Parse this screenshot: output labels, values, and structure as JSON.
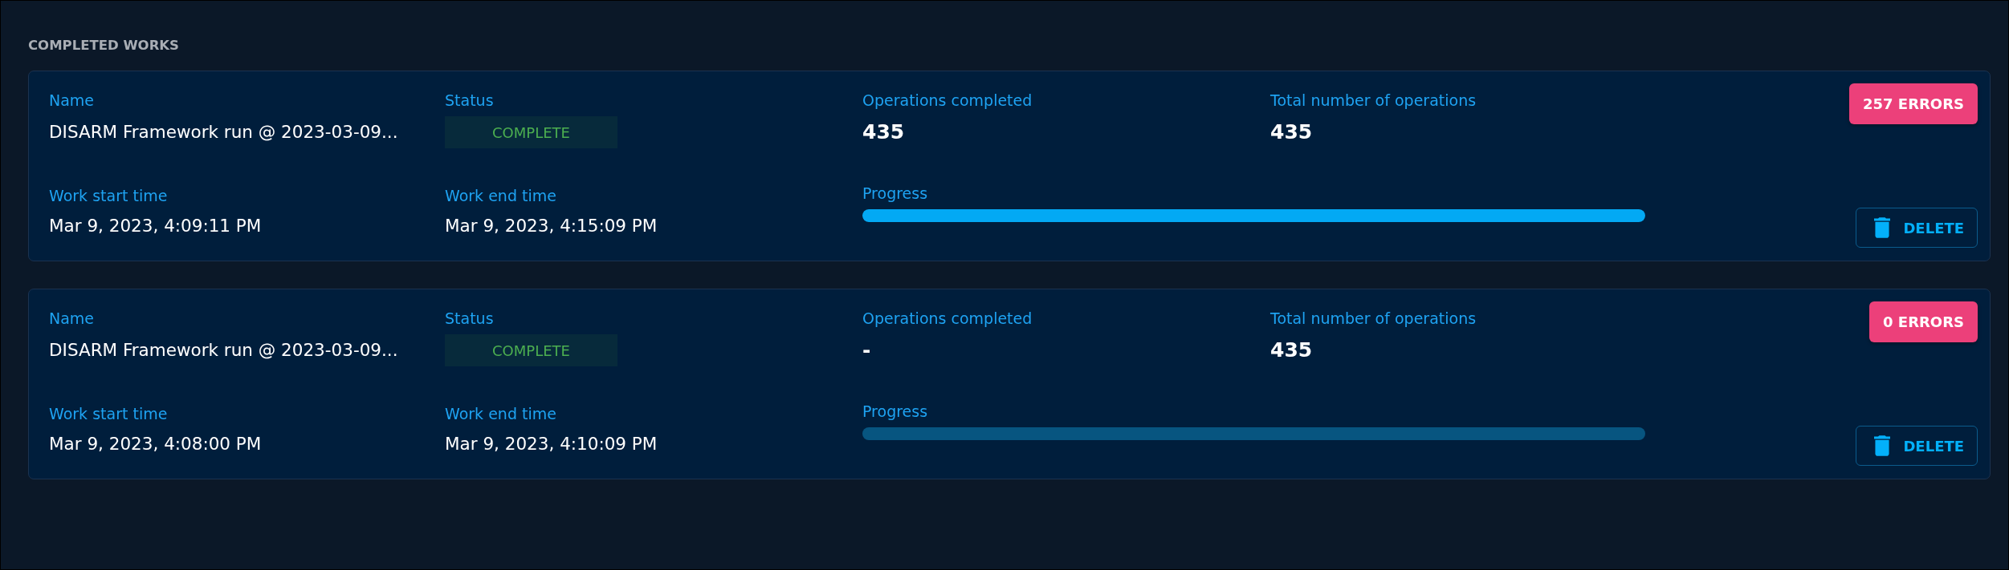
{
  "section": {
    "title": "COMPLETED WORKS"
  },
  "works": [
    {
      "name": {
        "label": "Name",
        "value": "DISARM Framework run @ 2023-03-09..."
      },
      "status": {
        "label": "Status",
        "value": "COMPLETE"
      },
      "operations_completed": {
        "label": "Operations completed",
        "value": "435"
      },
      "total_operations": {
        "label": "Total number of operations",
        "value": "435"
      },
      "errors_button": "257 ERRORS",
      "start_time": {
        "label": "Work start time",
        "value": "Mar 9, 2023, 4:09:11 PM"
      },
      "end_time": {
        "label": "Work end time",
        "value": "Mar 9, 2023, 4:15:09 PM"
      },
      "progress": {
        "label": "Progress",
        "level": 1
      },
      "delete_button": "DELETE"
    },
    {
      "name": {
        "label": "Name",
        "value": "DISARM Framework run @ 2023-03-09..."
      },
      "status": {
        "label": "Status",
        "value": "COMPLETE"
      },
      "operations_completed": {
        "label": "Operations completed",
        "value": "-"
      },
      "total_operations": {
        "label": "Total number of operations",
        "value": "435"
      },
      "errors_button": "0 ERRORS",
      "start_time": {
        "label": "Work start time",
        "value": "Mar 9, 2023, 4:08:00 PM"
      },
      "end_time": {
        "label": "Work end time",
        "value": "Mar 9, 2023, 4:10:09 PM"
      },
      "progress": {
        "label": "Progress",
        "level": 0
      },
      "delete_button": "DELETE"
    }
  ]
}
